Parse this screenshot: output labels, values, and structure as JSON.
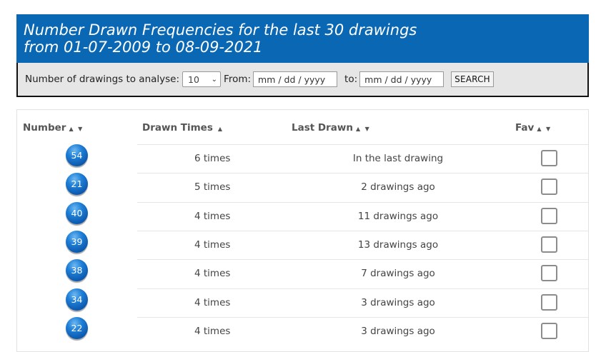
{
  "header": {
    "title_line1": "Number Drawn Frequencies for the last 30 drawings",
    "title_line2": "from 01-07-2009 to 08-09-2021"
  },
  "filters": {
    "analyse_label": "Number of drawings to analyse:",
    "analyse_value": "10",
    "from_label": "From:",
    "from_placeholder": "mm / dd / yyyy",
    "to_label": "to:",
    "to_placeholder": "mm / dd / yyyy",
    "search_label": "SEARCH"
  },
  "table": {
    "columns": {
      "number": "Number",
      "drawn_times": "Drawn Times",
      "last_drawn": "Last Drawn",
      "fav": "Fav"
    },
    "sort_icons": {
      "both": "▲ ▼",
      "up": "▲"
    },
    "rows": [
      {
        "number": "54",
        "times": "6 times",
        "last": "In the last drawing"
      },
      {
        "number": "21",
        "times": "5 times",
        "last": "2 drawings ago"
      },
      {
        "number": "40",
        "times": "4 times",
        "last": "11 drawings ago"
      },
      {
        "number": "39",
        "times": "4 times",
        "last": "13 drawings ago"
      },
      {
        "number": "38",
        "times": "4 times",
        "last": "7 drawings ago"
      },
      {
        "number": "34",
        "times": "4 times",
        "last": "3 drawings ago"
      },
      {
        "number": "22",
        "times": "4 times",
        "last": "3 drawings ago"
      }
    ]
  },
  "colors": {
    "banner": "#0a67b3",
    "ball": "#1f7fd6"
  }
}
